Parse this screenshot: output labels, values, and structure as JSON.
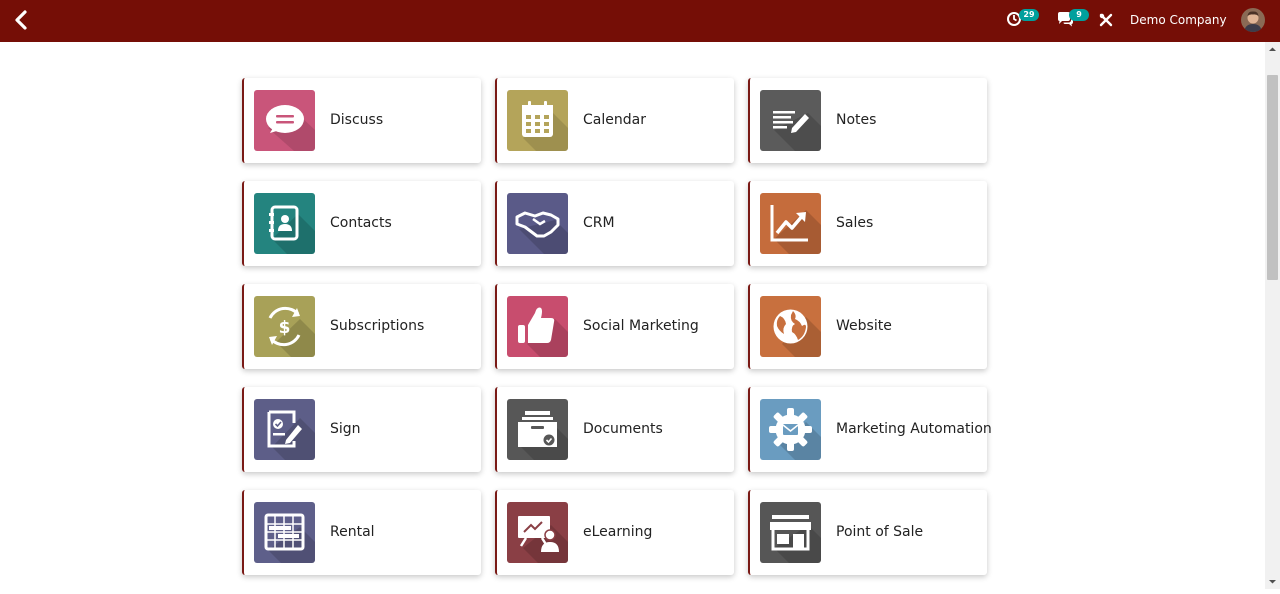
{
  "topbar": {
    "activity_count": "29",
    "messages_count": "9",
    "company_name": "Demo Company"
  },
  "apps": [
    {
      "label": "Discuss",
      "icon": "discuss-icon",
      "color": "#c9557a"
    },
    {
      "label": "Calendar",
      "icon": "calendar-icon",
      "color": "#b4a45a"
    },
    {
      "label": "Notes",
      "icon": "notes-icon",
      "color": "#5b5b5b"
    },
    {
      "label": "Contacts",
      "icon": "contacts-icon",
      "color": "#24847f"
    },
    {
      "label": "CRM",
      "icon": "handshake-icon",
      "color": "#5a5a88"
    },
    {
      "label": "Sales",
      "icon": "sales-chart-icon",
      "color": "#c56c3c"
    },
    {
      "label": "Subscriptions",
      "icon": "subscription-dollar-icon",
      "color": "#a8a158"
    },
    {
      "label": "Social Marketing",
      "icon": "thumbs-up-icon",
      "color": "#c84d6e"
    },
    {
      "label": "Website",
      "icon": "globe-icon",
      "color": "#c8703e"
    },
    {
      "label": "Sign",
      "icon": "sign-icon",
      "color": "#5d5e88"
    },
    {
      "label": "Documents",
      "icon": "documents-icon",
      "color": "#575757"
    },
    {
      "label": "Marketing Automation",
      "icon": "gear-mail-icon",
      "color": "#6a9cc0"
    },
    {
      "label": "Rental",
      "icon": "rental-icon",
      "color": "#5e5f8a"
    },
    {
      "label": "eLearning",
      "icon": "elearning-icon",
      "color": "#8a3f45"
    },
    {
      "label": "Point of Sale",
      "icon": "store-icon",
      "color": "#565656"
    }
  ]
}
